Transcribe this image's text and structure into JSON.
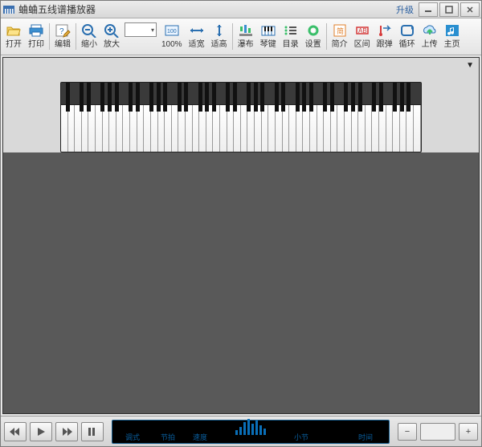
{
  "titlebar": {
    "title": "蛐蛐五线谱播放器",
    "upgrade": "升级"
  },
  "toolbar": {
    "open": "打开",
    "print": "打印",
    "edit": "编辑",
    "zoom_out": "缩小",
    "zoom_in": "放大",
    "zoom_value": "",
    "z100": "100%",
    "fitw": "适宽",
    "fith": "适高",
    "waterfall": "瀑布",
    "keyboard": "琴键",
    "toc": "目录",
    "settings": "设置",
    "intro": "简介",
    "range": "区间",
    "follow": "跟弹",
    "loop": "循环",
    "upload": "上传",
    "home": "主页"
  },
  "display": {
    "mode": "调式",
    "beat": "节拍",
    "tempo": "速度",
    "measure": "小节",
    "time": "时间"
  }
}
